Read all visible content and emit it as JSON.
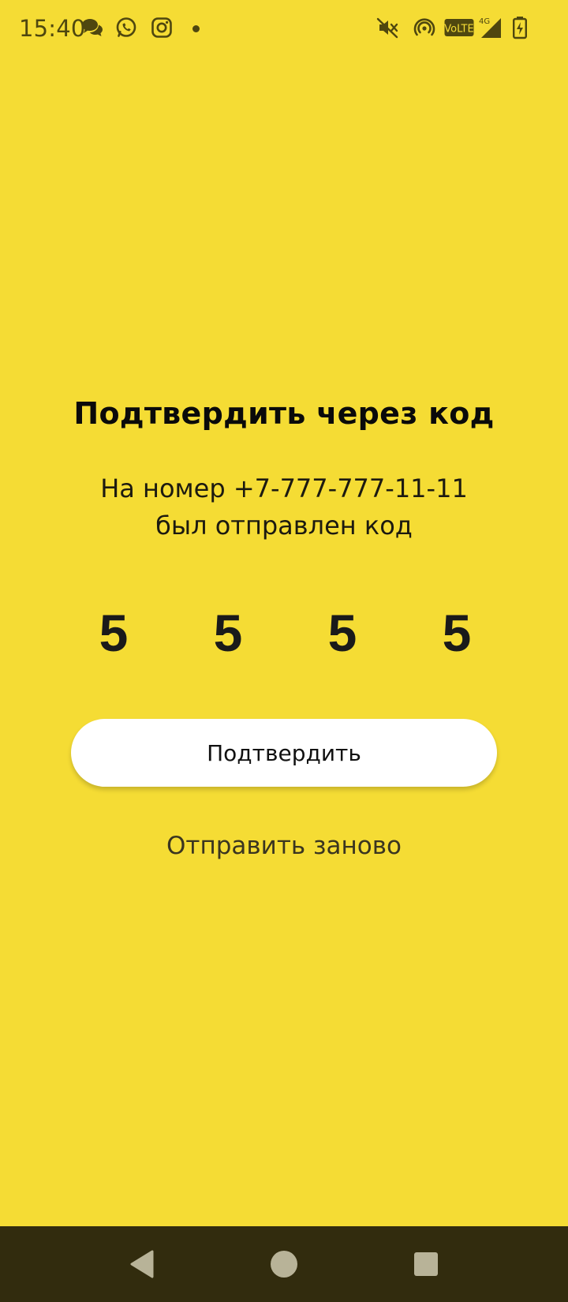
{
  "status_bar": {
    "time": "15:40",
    "icons": [
      "chat-bubbles-icon",
      "whatsapp-icon",
      "instagram-icon",
      "notification-dot",
      "mute-icon",
      "hotspot-icon",
      "volte-icon",
      "signal-4g-icon",
      "battery-charging-icon"
    ],
    "volte_label": "VoLTE",
    "network_label": "4G"
  },
  "screen": {
    "title": "Подтвердить через код",
    "subtitle_line1": "На номер +7-777-777-11-11",
    "subtitle_line2": "был отправлен код",
    "code": [
      "5",
      "5",
      "5",
      "5"
    ],
    "confirm_label": "Подтвердить",
    "resend_label": "Отправить заново"
  },
  "nav_bar": {
    "buttons": [
      "back-icon",
      "home-icon",
      "recents-icon"
    ]
  },
  "colors": {
    "background": "#f5dc34",
    "button_bg": "#ffffff",
    "nav_bar": "#322c0e",
    "status_icons": "#4f470f"
  }
}
